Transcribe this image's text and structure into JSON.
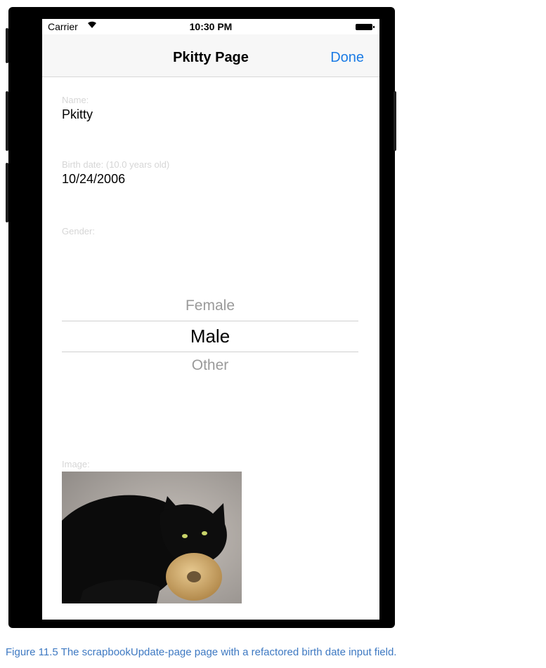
{
  "status_bar": {
    "carrier": "Carrier",
    "wifi_icon": "wifi-icon",
    "time": "10:30 PM",
    "battery_icon": "battery-icon"
  },
  "nav": {
    "title": "Pkitty Page",
    "done_label": "Done"
  },
  "form": {
    "name_label": "Name:",
    "name_value": "Pkitty",
    "birth_label": "Birth date: (10.0 years old)",
    "birth_value": "10/24/2006",
    "gender_label": "Gender:",
    "gender_options": [
      "Female",
      "Male",
      "Other"
    ],
    "gender_selected": "Male",
    "image_label": "Image:"
  },
  "caption": "Figure 11.5 The scrapbookUpdate-page page with a refactored birth date input field.",
  "colors": {
    "accent": "#1b7be5",
    "caption": "#3e79c2",
    "label": "#d6d6d6"
  }
}
